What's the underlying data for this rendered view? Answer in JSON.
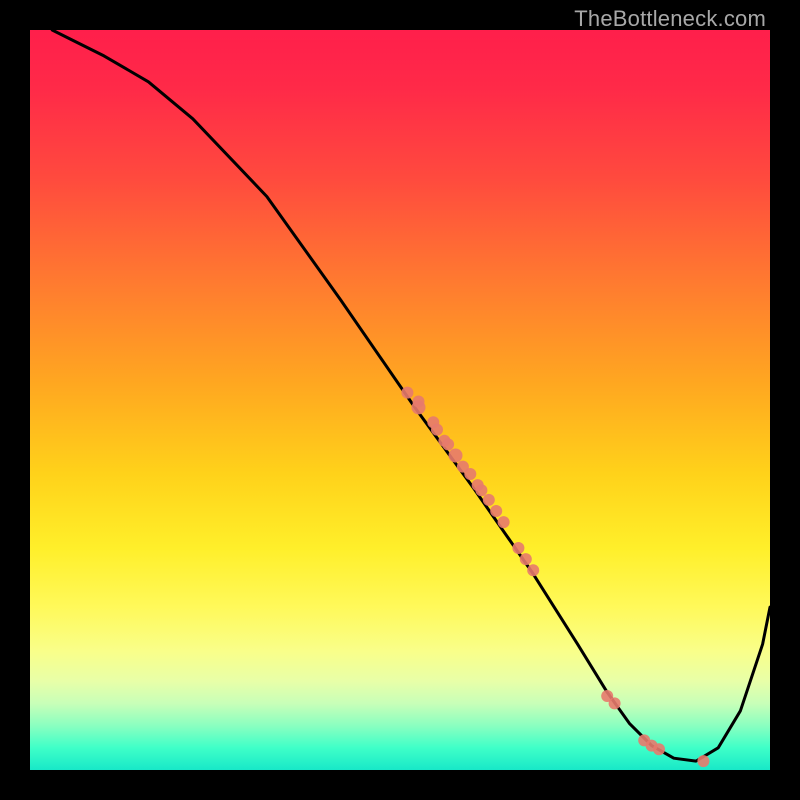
{
  "brand": "TheBottleneck.com",
  "chart_data": {
    "type": "line",
    "title": "",
    "xlabel": "",
    "ylabel": "",
    "xlim": [
      0,
      100
    ],
    "ylim": [
      0,
      100
    ],
    "grid": false,
    "series": [
      {
        "name": "curve",
        "x": [
          3,
          6,
          10,
          16,
          22,
          32,
          42,
          52,
          60,
          68,
          74,
          78,
          81,
          84,
          87,
          90,
          93,
          96,
          99,
          100
        ],
        "y": [
          100,
          98.5,
          96.5,
          93,
          88,
          77.5,
          63.5,
          49,
          38,
          26.5,
          17,
          10.5,
          6.3,
          3.3,
          1.6,
          1.2,
          3,
          8,
          17,
          22
        ]
      }
    ],
    "scatter_points": {
      "name": "markers",
      "color": "#e77a6d",
      "x": [
        51,
        52.5,
        52.5,
        54.5,
        55,
        56,
        56.5,
        57.5,
        58.5,
        59.5,
        60.5,
        61,
        62,
        63,
        64,
        66,
        67,
        68,
        78,
        79,
        83,
        84,
        85,
        91
      ],
      "y": [
        51,
        49,
        49.8,
        47,
        46,
        44.5,
        44,
        42.5,
        41,
        40,
        38.5,
        37.8,
        36.5,
        35,
        33.5,
        30,
        28.5,
        27,
        10,
        9,
        4,
        3.3,
        2.8,
        1.2
      ],
      "r": [
        6,
        7,
        6,
        6,
        6,
        6,
        6,
        7,
        6,
        6,
        6,
        6,
        6,
        6,
        6,
        6,
        6,
        6,
        6,
        6,
        6,
        6,
        6,
        6
      ]
    }
  }
}
